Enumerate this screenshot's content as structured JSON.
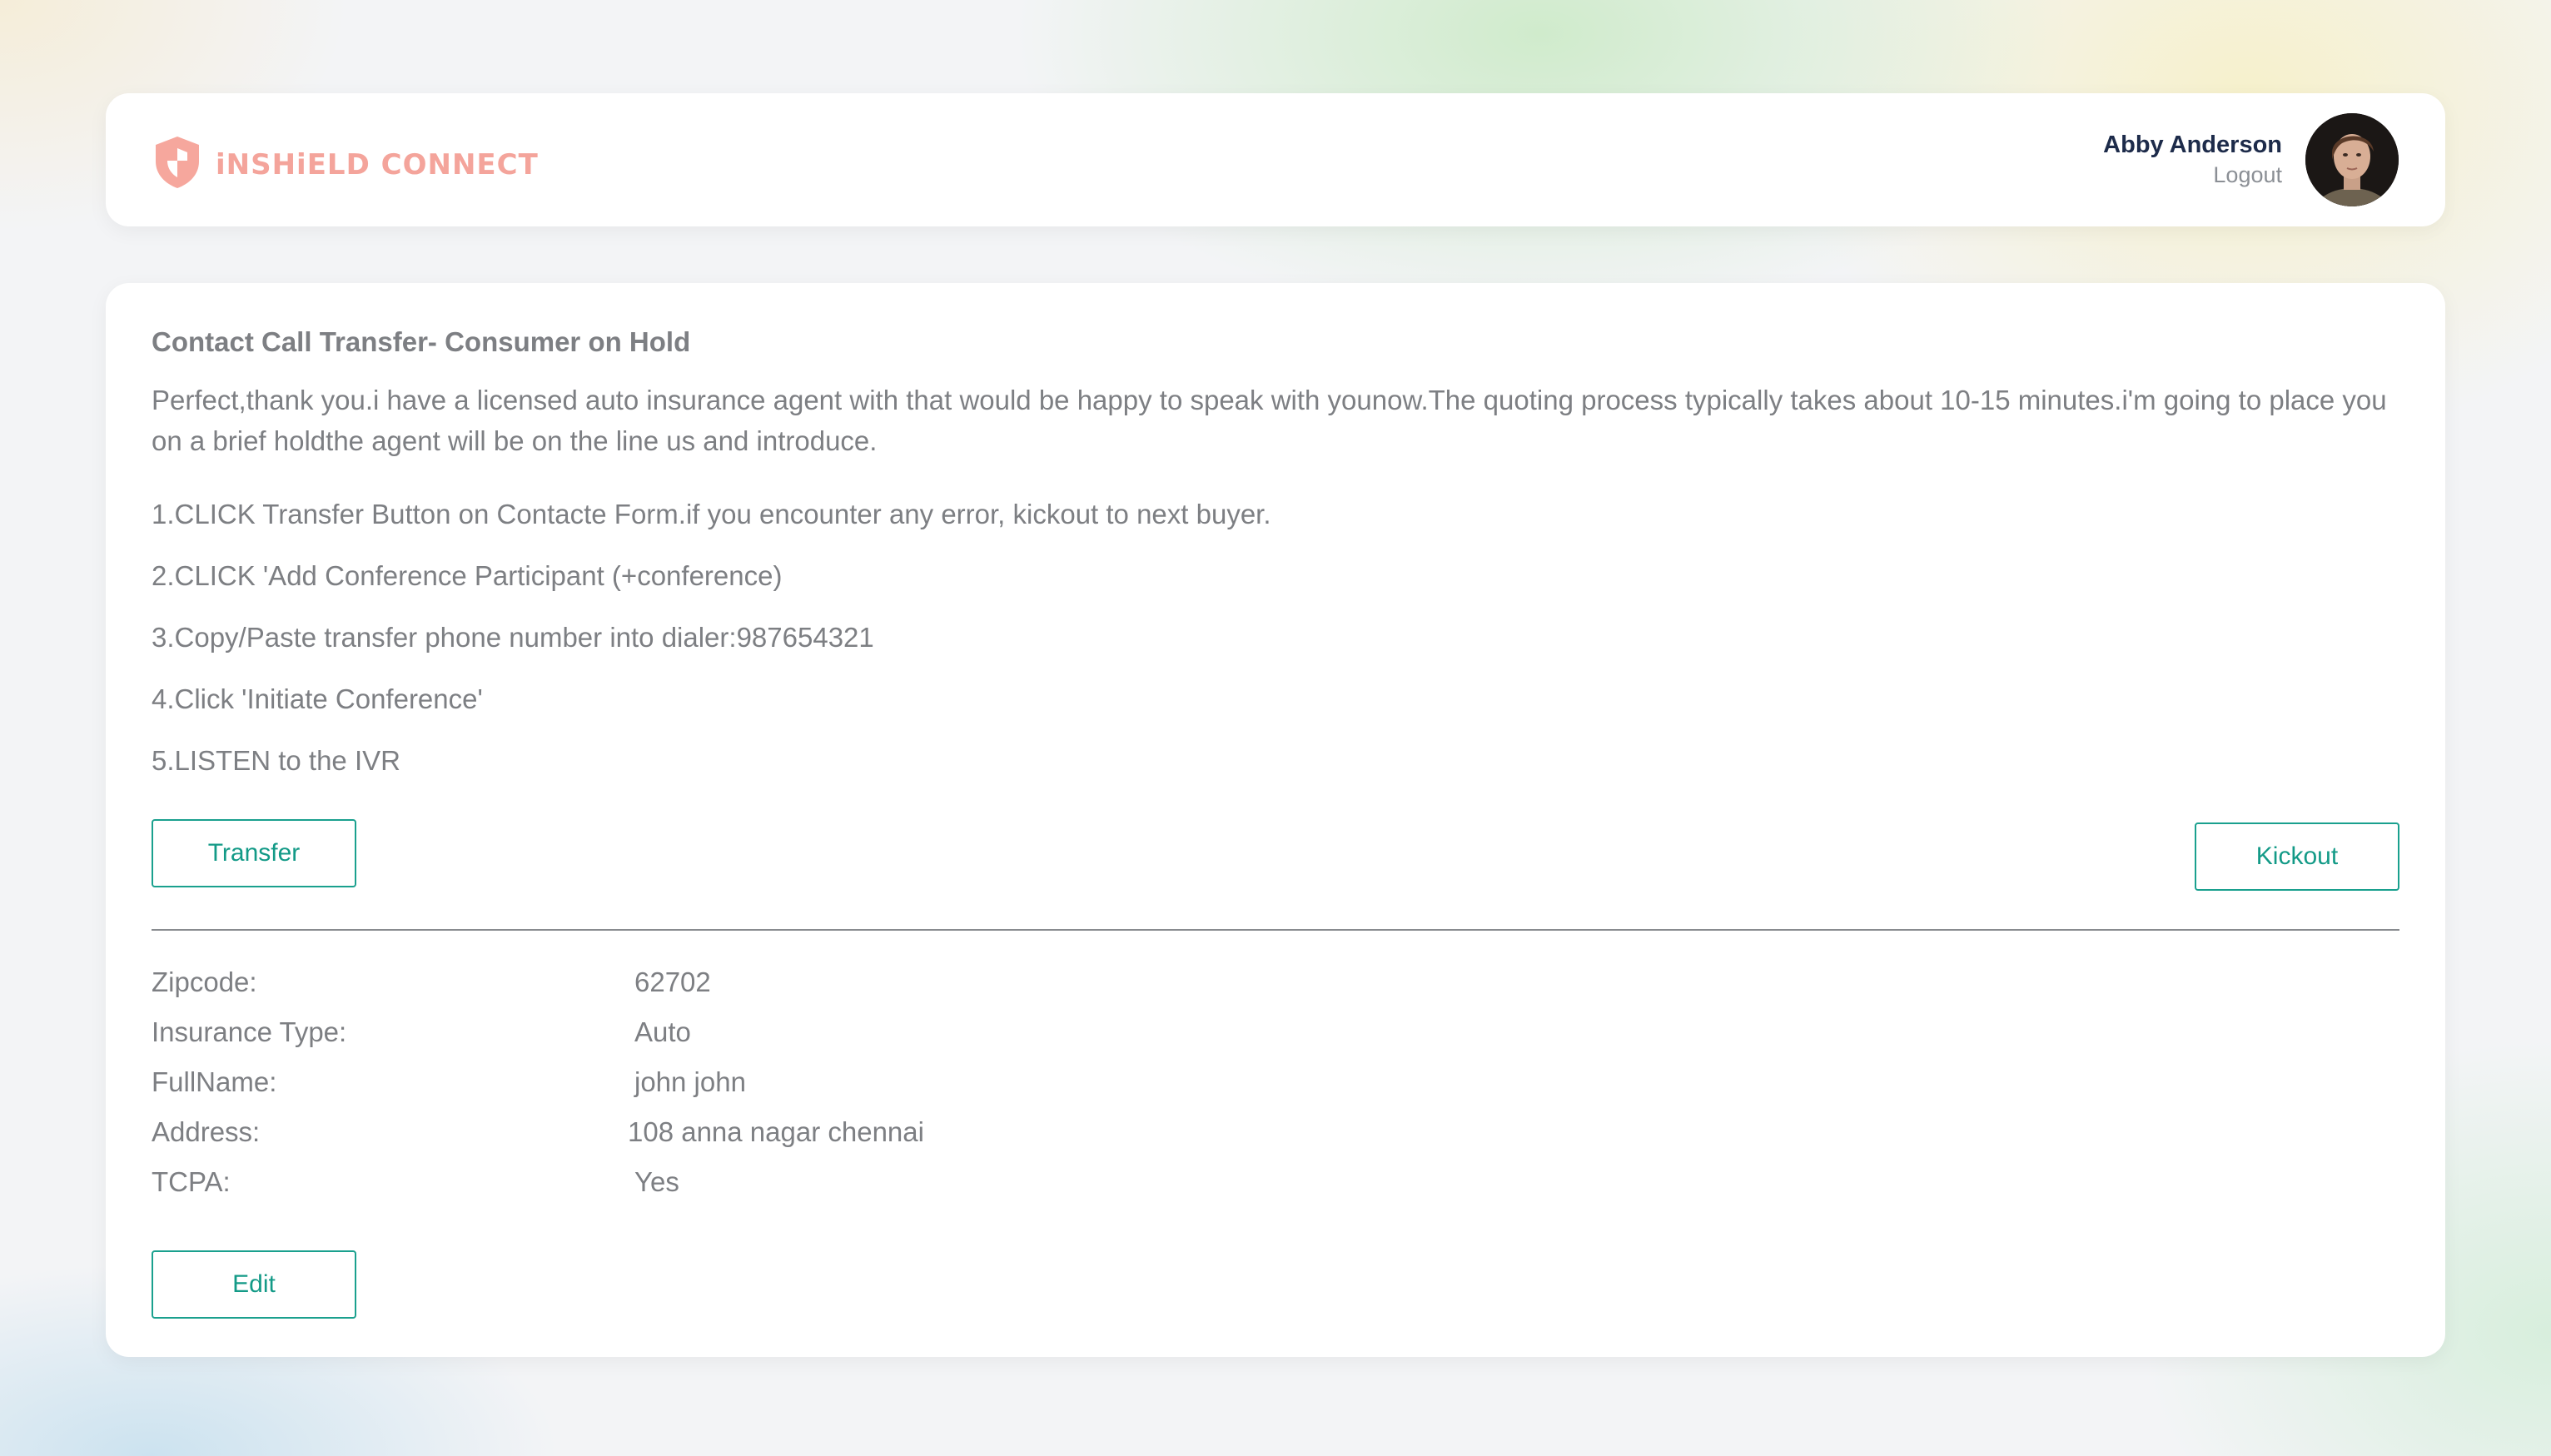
{
  "app": {
    "logo_text": "iNSHiELD CONNECT"
  },
  "user": {
    "name": "Abby Anderson",
    "logout_label": "Logout"
  },
  "call": {
    "title": "Contact Call Transfer- Consumer on Hold",
    "script": "Perfect,thank you.i have a licensed auto insurance agent with that would be happy to speak with younow.The quoting process typically takes about 10-15 minutes.i'm going to place you on a brief holdthe agent will be on the line us and introduce.",
    "steps": [
      "1.CLICK Transfer Button on Contacte Form.if you encounter any error, kickout to next buyer.",
      "2.CLICK 'Add Conference Participant (+conference)",
      "3.Copy/Paste transfer phone number into dialer:987654321",
      "4.Click 'Initiate Conference'",
      "5.LISTEN to the IVR"
    ],
    "transfer_label": "Transfer",
    "kickout_label": "Kickout"
  },
  "contact": {
    "fields": [
      {
        "label": "Zipcode:",
        "value": "62702"
      },
      {
        "label": "Insurance Type:",
        "value": "Auto"
      },
      {
        "label": "FullName:",
        "value": "john john"
      },
      {
        "label": "Address:",
        "value": "108 anna nagar chennai"
      },
      {
        "label": "TCPA:",
        "value": "Yes"
      }
    ],
    "edit_label": "Edit"
  },
  "colors": {
    "accent": "#1aa08e",
    "logo": "#f4a49b",
    "user_name": "#1d2b4a",
    "text": "#7d7f83"
  },
  "icons": {
    "logo": "shield-icon"
  }
}
